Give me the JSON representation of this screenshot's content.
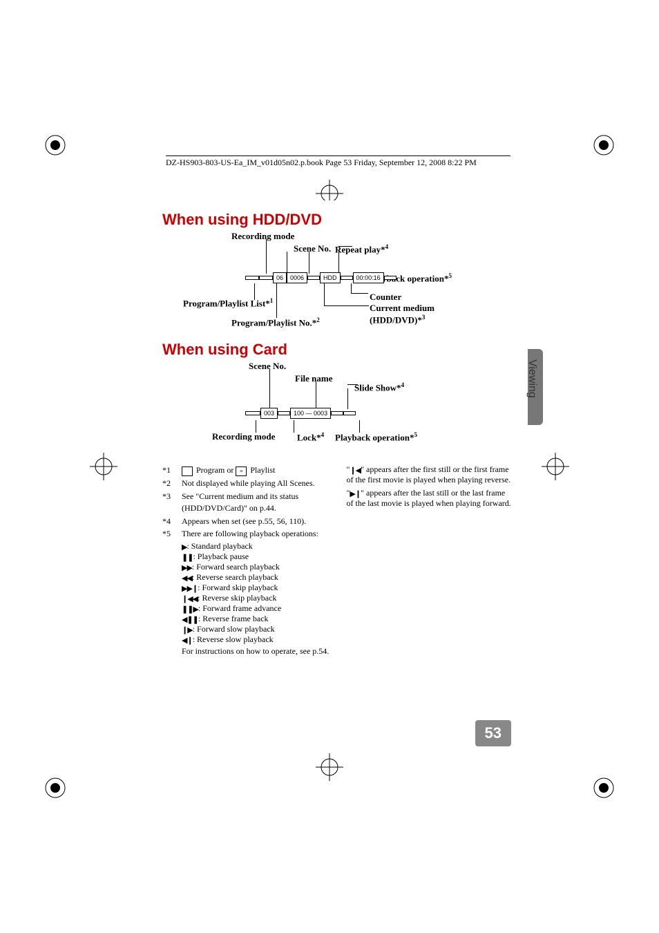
{
  "header": "DZ-HS903-803-US-Ea_IM_v01d05n02.p.book  Page 53  Friday, September 12, 2008  8:22 PM",
  "section_tab": "Viewing",
  "page_number": "53",
  "h1": "When using HDD/DVD",
  "h2": "When using Card",
  "diag1": {
    "recording_mode": "Recording mode",
    "scene_no": "Scene No.",
    "repeat_play": "Repeat play*",
    "repeat_sup": "4",
    "playback_op": "Playback operation*",
    "playback_sup": "5",
    "counter": "Counter",
    "current_medium": "Current medium (HDD/DVD)*",
    "current_sup": "3",
    "prog_list": "Program/Playlist List*",
    "prog_list_sup": "1",
    "prog_no": "Program/Playlist No.*",
    "prog_no_sup": "2",
    "bar": [
      "",
      "",
      "06",
      "0006",
      "",
      "HDD",
      "",
      "00:00:16",
      ""
    ]
  },
  "diag2": {
    "scene_no": "Scene No.",
    "file_name": "File name",
    "slide_show": "Slide Show*",
    "slide_sup": "4",
    "recording_mode": "Recording mode",
    "lock": "Lock*",
    "lock_sup": "4",
    "playback_op": "Playback operation*",
    "playback_sup": "5",
    "bar": [
      "",
      "003",
      "",
      "100 — 0003",
      "",
      ""
    ]
  },
  "fn": {
    "n1_label": "*1",
    "n1_text_a": "Program or",
    "n1_text_b": "Playlist",
    "n2_label": "*2",
    "n2_text": "Not displayed while playing All Scenes.",
    "n3_label": "*3",
    "n3_text": "See \"Current medium and its status (HDD/DVD/Card)\" on p.44.",
    "n4_label": "*4",
    "n4_text": "Appears when set (see p.55, 56, 110).",
    "n5_label": "*5",
    "n5_text": "There are following playback operations:",
    "ops": [
      {
        "sym": "▶",
        "txt": ": Standard playback"
      },
      {
        "sym": "❚❚",
        "txt": ": Playback pause"
      },
      {
        "sym": "▶▶",
        "txt": ": Forward search playback"
      },
      {
        "sym": "◀◀",
        "txt": ": Reverse search playback"
      },
      {
        "sym": "▶▶❙",
        "txt": ": Forward skip playback"
      },
      {
        "sym": "❙◀◀",
        "txt": ": Reverse skip playback"
      },
      {
        "sym": "❚❚▶",
        "txt": ": Forward frame advance"
      },
      {
        "sym": "◀❚❚",
        "txt": ": Reverse frame back"
      },
      {
        "sym": "❙▶",
        "txt": ": Forward slow playback"
      },
      {
        "sym": "◀❙",
        "txt": ": Reverse slow playback"
      }
    ],
    "instr": "For instructions on how to operate, see p.54.",
    "right1_a": "\"",
    "right1_sym": "❙◀",
    "right1_b": "\" appears after the first still or the first frame of the first movie is played when playing reverse.",
    "right2_a": "\"",
    "right2_sym": "▶❙",
    "right2_b": "\" appears after the last still or the last frame of the last movie is played when playing forward."
  }
}
